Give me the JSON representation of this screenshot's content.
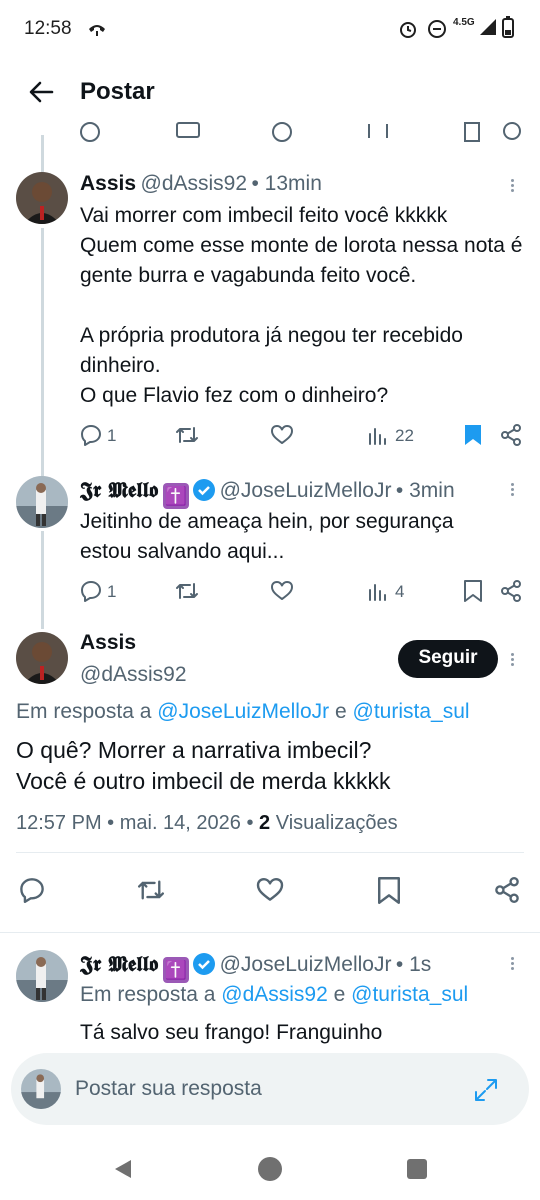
{
  "status_bar": {
    "time": "12:58",
    "network": "4.5G"
  },
  "header": {
    "title": "Postar"
  },
  "tweet1": {
    "name": "Assis",
    "handle": "@dAssis92",
    "time": "• 13min",
    "text": "Vai morrer com imbecil feito você kkkkk\nQuem come esse monte de lorota nessa nota é gente burra e vagabunda feito você.\n\nA própria produtora já negou ter recebido dinheiro.\nO que Flavio fez com o dinheiro?",
    "replies": "1",
    "views": "22"
  },
  "tweet2": {
    "name": "𝕵𝖗 𝕸𝖊𝖑𝖑𝖔",
    "emoji": "✝️",
    "handle": "@JoseLuizMelloJr",
    "time": "• 3min",
    "text": "Jeitinho de ameaça hein, por segurança estou salvando aqui...",
    "replies": "1",
    "views": "4"
  },
  "main_tweet": {
    "name": "Assis",
    "handle": "@dAssis92",
    "follow_label": "Seguir",
    "reply_prefix": "Em resposta a",
    "reply_to_1": "@JoseLuizMelloJr",
    "reply_and": "e",
    "reply_to_2": "@turista_sul",
    "text": "O quê? Morrer a narrativa imbecil?\nVocê é outro imbecil de merda kkkkk",
    "timestamp": "12:57 PM • mai. 14, 2026 •",
    "views_count": "2",
    "views_label": "Visualizações"
  },
  "reply_tweet": {
    "name": "𝕵𝖗 𝕸𝖊𝖑𝖑𝖔",
    "emoji": "✝️",
    "handle": "@JoseLuizMelloJr",
    "time": "• 1s",
    "reply_prefix": "Em resposta a",
    "reply_to_1": "@dAssis92",
    "reply_and": "e",
    "reply_to_2": "@turista_sul",
    "text": "Tá salvo seu frango! Franguinho"
  },
  "composer": {
    "placeholder": "Postar sua resposta"
  },
  "colors": {
    "accent": "#1d9bf0",
    "text": "#0f1419",
    "muted": "#536471"
  }
}
